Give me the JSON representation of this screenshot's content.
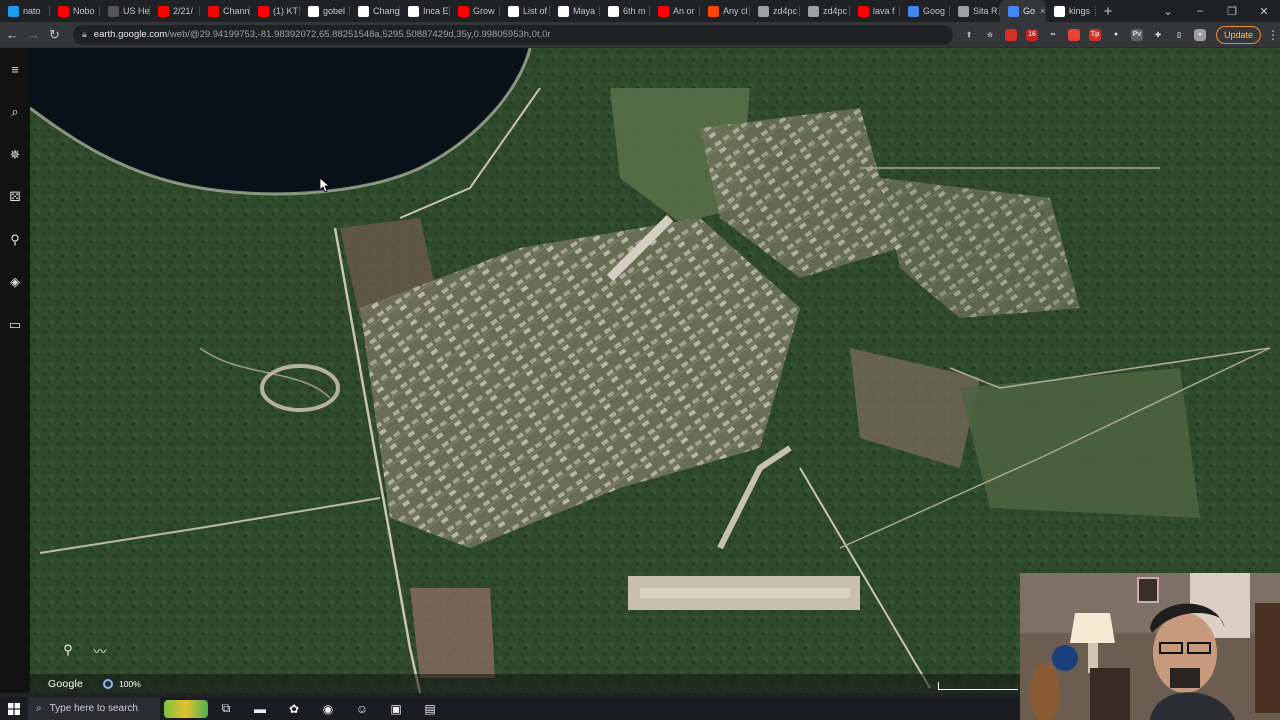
{
  "tabs": [
    {
      "label": "nato",
      "icon": "twitter-icon",
      "color": "#1d9bf0"
    },
    {
      "label": "Nobo",
      "icon": "youtube-icon",
      "color": "#ff0000"
    },
    {
      "label": "US He",
      "icon": "wikipedia-like-icon",
      "color": "#555555"
    },
    {
      "label": "2/21/",
      "icon": "youtube-icon",
      "color": "#ff0000"
    },
    {
      "label": "Chann",
      "icon": "youtube-icon",
      "color": "#ff0000"
    },
    {
      "label": "(1) KT",
      "icon": "youtube-icon",
      "color": "#ff0000"
    },
    {
      "label": "gobel",
      "icon": "google-icon",
      "color": "#ffffff"
    },
    {
      "label": "Chang",
      "icon": "wikipedia-icon",
      "color": "#ffffff"
    },
    {
      "label": "Inca E",
      "icon": "wikipedia-icon",
      "color": "#ffffff"
    },
    {
      "label": "Grow",
      "icon": "youtube-icon",
      "color": "#ff0000"
    },
    {
      "label": "List of",
      "icon": "wikipedia-icon",
      "color": "#ffffff"
    },
    {
      "label": "Maya",
      "icon": "wikipedia-icon",
      "color": "#ffffff"
    },
    {
      "label": "6th m",
      "icon": "wikipedia-icon",
      "color": "#ffffff"
    },
    {
      "label": "An or",
      "icon": "youtube-icon",
      "color": "#ff0000"
    },
    {
      "label": "Any cl",
      "icon": "reddit-icon",
      "color": "#ff4500"
    },
    {
      "label": "zd4pc",
      "icon": "web-icon",
      "color": "#9aa0a6"
    },
    {
      "label": "zd4pc",
      "icon": "web-icon",
      "color": "#9aa0a6"
    },
    {
      "label": "lava f",
      "icon": "youtube-icon",
      "color": "#ff0000"
    },
    {
      "label": "Goog",
      "icon": "google-icon",
      "color": "#4285f4"
    },
    {
      "label": "Sita R",
      "icon": "web-icon",
      "color": "#9aa0a6"
    },
    {
      "label": "Go",
      "icon": "google-earth-icon",
      "color": "#4285f4",
      "active": true
    },
    {
      "label": "kings",
      "icon": "google-icon",
      "color": "#ffffff"
    }
  ],
  "active_tab_close": "×",
  "new_tab": "+",
  "window_controls": {
    "tab_search": "⌄",
    "minimize": "–",
    "restore": "❐",
    "close": "✕"
  },
  "toolbar": {
    "back": "←",
    "forward": "→",
    "reload": "↻",
    "url_domain": "earth.google.com",
    "url_path": "/web/@29.94199753,-81.98392072,65.88251548a,5295.50887429d,35y,0.99805953h,0t,0r",
    "update_label": "Update",
    "menu": "⋮"
  },
  "extensions": [
    {
      "name": "share-icon",
      "glyph": "⇪",
      "color": "transparent"
    },
    {
      "name": "star-icon",
      "glyph": "☆",
      "color": "transparent"
    },
    {
      "name": "ext-red-icon",
      "glyph": "",
      "color": "#d93025"
    },
    {
      "name": "ext-badge-icon",
      "glyph": "16",
      "color": "#c5221f"
    },
    {
      "name": "ext-glasses-icon",
      "glyph": "∞",
      "color": "transparent"
    },
    {
      "name": "ext-red2-icon",
      "glyph": "",
      "color": "#ea4335"
    },
    {
      "name": "ext-tp-icon",
      "glyph": "Tp",
      "color": "#d93025"
    },
    {
      "name": "ext-circle-icon",
      "glyph": "●",
      "color": "transparent"
    },
    {
      "name": "ext-pv-icon",
      "glyph": "Pv",
      "color": "#5f6368"
    },
    {
      "name": "puzzle-icon",
      "glyph": "✚",
      "color": "transparent"
    },
    {
      "name": "sidebar-icon",
      "glyph": "▯",
      "color": "transparent"
    },
    {
      "name": "profile-avatar-icon",
      "glyph": "●",
      "color": "#9e9e9e"
    }
  ],
  "earth_rail": [
    {
      "name": "menu-icon",
      "glyph": "≡"
    },
    {
      "name": "search-icon",
      "glyph": "⌕"
    },
    {
      "name": "voyager-icon",
      "glyph": "✵"
    },
    {
      "name": "feeling-lucky-icon",
      "glyph": "⚄"
    },
    {
      "name": "projects-icon",
      "glyph": "⚲"
    },
    {
      "name": "map-style-icon",
      "glyph": "◈"
    },
    {
      "name": "measure-icon",
      "glyph": "▭"
    }
  ],
  "map_controls": [
    {
      "name": "add-placemark-icon",
      "glyph": "⚲"
    },
    {
      "name": "add-path-icon",
      "glyph": "〰"
    }
  ],
  "status": {
    "brand": "Google",
    "load_percent": "100%"
  },
  "taskbar": {
    "search_placeholder": "Type here to search",
    "apps": [
      {
        "name": "task-view-icon",
        "glyph": "⧉"
      },
      {
        "name": "file-explorer-icon",
        "glyph": "▬"
      },
      {
        "name": "settings-app-icon",
        "glyph": "✿"
      },
      {
        "name": "chrome-icon",
        "glyph": "◉"
      },
      {
        "name": "discord-icon",
        "glyph": "☺"
      },
      {
        "name": "photos-app-icon",
        "glyph": "▣"
      },
      {
        "name": "teal-app-icon",
        "glyph": "▤"
      }
    ]
  },
  "colors": {
    "forest": "#2e4a2a",
    "lake": "#081018",
    "accent_update": "#f28b30"
  }
}
